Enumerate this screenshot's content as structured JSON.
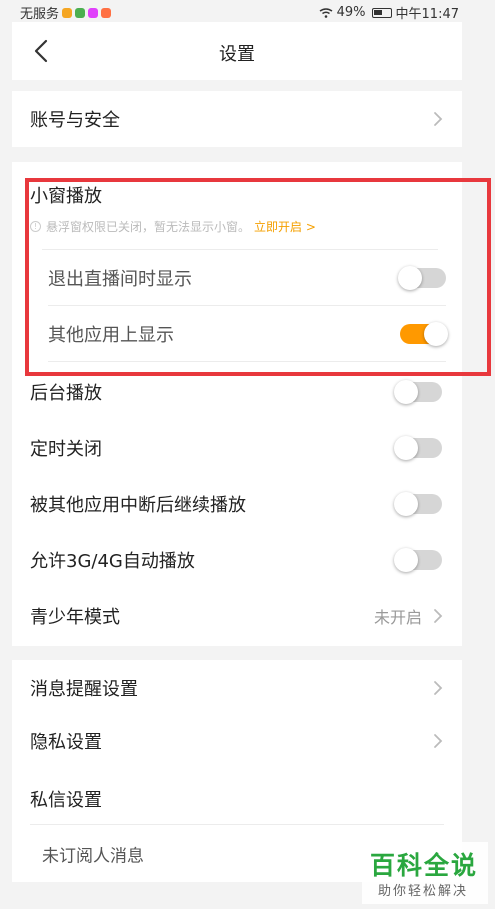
{
  "status_bar": {
    "carrier": "无服务",
    "battery": "49%",
    "time": "中午11:47"
  },
  "nav": {
    "title": "设置"
  },
  "account": {
    "label": "账号与安全"
  },
  "mini_window": {
    "title": "小窗播放",
    "notice_text": "悬浮窗权限已关闭，暂无法显示小窗。",
    "notice_link": "立即开启 >",
    "items": [
      {
        "label": "退出直播间时显示",
        "on": false
      },
      {
        "label": "其他应用上显示",
        "on": true
      }
    ]
  },
  "playback": {
    "items": [
      {
        "label": "后台播放",
        "on": false
      },
      {
        "label": "定时关闭",
        "on": false
      },
      {
        "label": "被其他应用中断后继续播放",
        "on": false
      },
      {
        "label": "允许3G/4G自动播放",
        "on": false
      }
    ],
    "youth_mode": {
      "label": "青少年模式",
      "value": "未开启"
    }
  },
  "messages": {
    "notification_label": "消息提醒设置",
    "privacy_label": "隐私设置",
    "dm_title": "私信设置",
    "dm_item": "未订阅人消息"
  },
  "watermark": {
    "title": "百科全说",
    "subtitle": "助你轻松解决"
  },
  "colors": {
    "accent": "#ff9900",
    "highlight": "#e8383d",
    "watermark_green": "#2aa73f"
  }
}
